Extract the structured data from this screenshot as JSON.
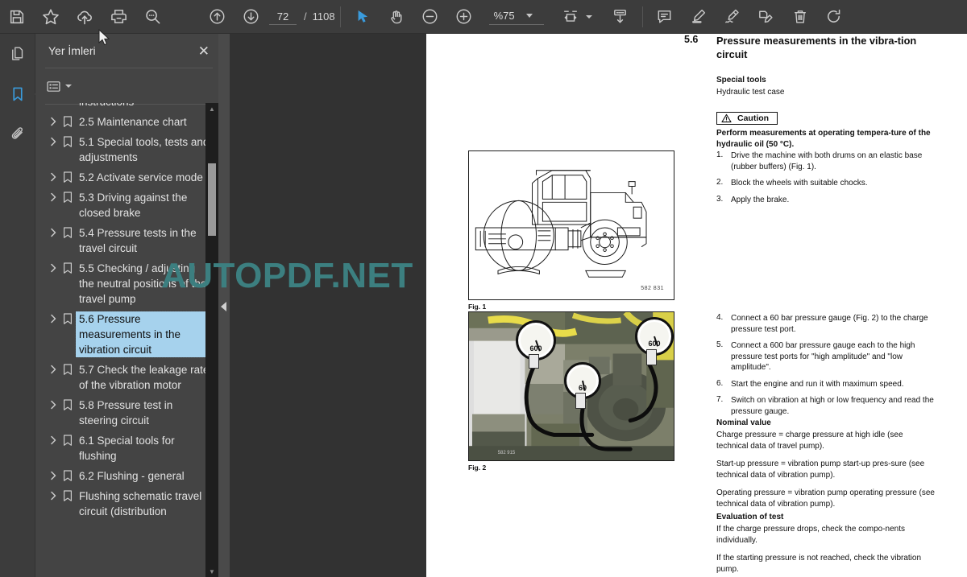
{
  "toolbar": {
    "left_buttons": [
      {
        "name": "save-icon",
        "label": "Kaydet"
      },
      {
        "name": "favorite-star-icon",
        "label": "Favori"
      },
      {
        "name": "cloud-upload-icon",
        "label": "Buluta Yükle"
      },
      {
        "name": "print-icon",
        "label": "Yazdır"
      },
      {
        "name": "search-icon",
        "label": "Ara"
      }
    ],
    "page_up_label": "Önceki sayfa",
    "page_down_label": "Sonraki sayfa",
    "page_current": "72",
    "page_separator": "/",
    "page_total": "1108",
    "select_tool_label": "Seç",
    "hand_tool_label": "El aracı",
    "zoom_out_label": "Uzaklaştır",
    "zoom_in_label": "Yakınlaştır",
    "zoom_value": "%75",
    "fit_page_label": "Sayfaya sığdır",
    "insert_page_label": "Sayfa ekle",
    "right_buttons": [
      {
        "name": "comment-icon",
        "label": "Yorum"
      },
      {
        "name": "highlighter-icon",
        "label": "Vurgula"
      },
      {
        "name": "signature-icon",
        "label": "İmza"
      },
      {
        "name": "stamp-edit-icon",
        "label": "Damga"
      },
      {
        "name": "trash-icon",
        "label": "Sil"
      },
      {
        "name": "rotate-icon",
        "label": "Döndür"
      }
    ]
  },
  "rail": {
    "pages_label": "Sayfalar",
    "bookmarks_label": "Yer İmleri",
    "attachments_label": "Ekler"
  },
  "panel": {
    "title": "Yer İmleri",
    "close_label": "✕",
    "options_label": "Seçenekler",
    "search_placeholder": ""
  },
  "bookmarks": [
    {
      "label": "instructions",
      "selected": false,
      "clipped": true
    },
    {
      "label": "2.5 Maintenance chart",
      "selected": false
    },
    {
      "label": "5.1 Special tools, tests and adjustments",
      "selected": false
    },
    {
      "label": "5.2 Activate service mode",
      "selected": false
    },
    {
      "label": "5.3 Driving against the closed brake",
      "selected": false
    },
    {
      "label": "5.4 Pressure tests in the travel circuit",
      "selected": false
    },
    {
      "label": "5.5 Checking / adjusting the neutral positions of the travel pump",
      "selected": false
    },
    {
      "label": "5.6 Pressure measurements in the vibration circuit",
      "selected": true
    },
    {
      "label": "5.7 Check the leakage rate of the vibration motor",
      "selected": false
    },
    {
      "label": "5.8 Pressure test in steering circuit",
      "selected": false
    },
    {
      "label": "6.1 Special tools for flushing",
      "selected": false
    },
    {
      "label": "6.2 Flushing - general",
      "selected": false
    },
    {
      "label": "Flushing schematic travel circuit (distribution",
      "selected": false
    }
  ],
  "document": {
    "section_number": "5.6",
    "section_title": "Pressure measurements in the vibra-tion circuit",
    "special_tools_head": "Special tools",
    "special_tools_text": "Hydraulic test case",
    "caution_label": "Caution",
    "caution_text": "Perform measurements at operating tempera-ture of the hydraulic oil (50 °C).",
    "steps_left": [
      {
        "n": "1.",
        "text": "Drive the machine with both drums on an elastic base (rubber buffers) (Fig. 1)."
      },
      {
        "n": "2.",
        "text": "Block the wheels with suitable chocks."
      },
      {
        "n": "3.",
        "text": "Apply the brake."
      }
    ],
    "steps_right": [
      {
        "n": "4.",
        "text": "Connect a 60 bar pressure gauge (Fig. 2) to the charge pressure test port."
      },
      {
        "n": "5.",
        "text": "Connect a 600 bar pressure gauge each to the high pressure test ports for \"high amplitude\" and \"low amplitude\"."
      },
      {
        "n": "6.",
        "text": "Start the engine and run it with maximum speed."
      },
      {
        "n": "7.",
        "text": "Switch on vibration at high or low frequency and read the pressure gauge."
      }
    ],
    "nominal_head": "Nominal value",
    "nominal_lines": [
      "Charge pressure = charge pressure at high idle (see technical data of travel pump).",
      "Start-up pressure  = vibration pump start-up pres-sure (see technical data of vibration pump).",
      "Operating pressure  = vibration pump operating pressure (see technical data of vibration pump)."
    ],
    "evaluation_head": "Evaluation of test",
    "evaluation_lines": [
      "If the charge pressure drops, check the compo-nents individually.",
      "If the starting pressure is not reached, check the vibration pump."
    ],
    "fig1_caption": "Fig. 1",
    "fig1_code": "582 831",
    "fig2_caption": "Fig. 2",
    "fig2_code": "582 915",
    "gauge_labels": [
      "600",
      "60",
      "600"
    ]
  },
  "watermark": {
    "text": "AUTOPDF.NET",
    "color": "#3c7f80"
  },
  "colors": {
    "accent": "#3a9bdc",
    "selection": "#a6d2ed",
    "toolbar_bg": "#3c3c3c",
    "panel_bg": "#444444"
  }
}
